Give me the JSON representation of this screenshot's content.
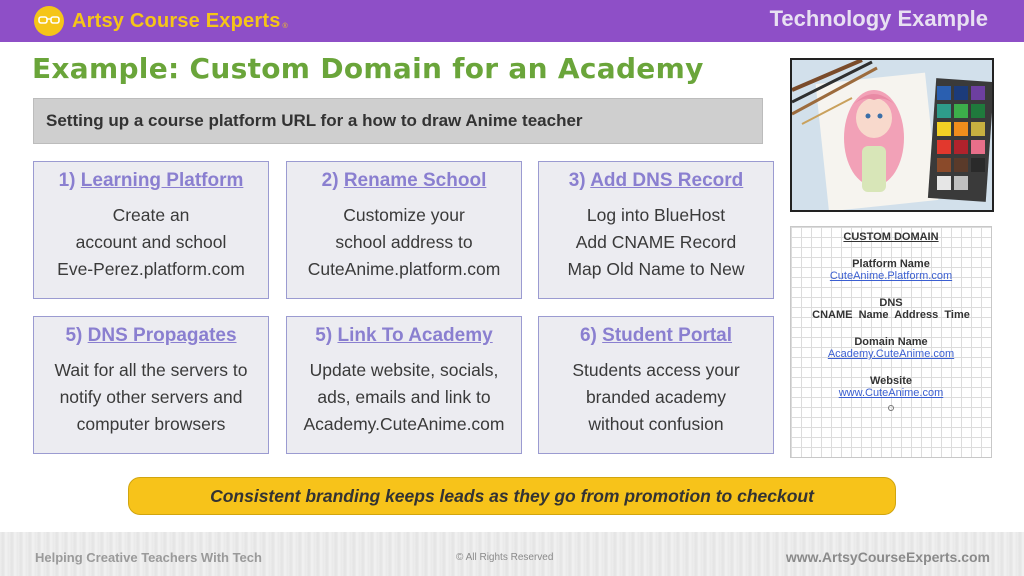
{
  "header": {
    "brand_name": "Artsy Course Experts",
    "brand_tm": "®",
    "section_label": "Technology Example"
  },
  "title": "Example: Custom Domain for an Academy",
  "subtitle": "Setting up a course platform URL for a how to draw Anime teacher",
  "steps": [
    {
      "num": "1)",
      "title": "Learning Platform",
      "lines": [
        "Create an",
        "account and school",
        "Eve-Perez.platform.com"
      ]
    },
    {
      "num": "2)",
      "title": "Rename School",
      "lines": [
        "Customize your",
        "school address to",
        "CuteAnime.platform.com"
      ]
    },
    {
      "num": "3)",
      "title": "Add DNS Record",
      "lines": [
        "Log into BlueHost",
        "Add CNAME Record",
        "Map Old Name to New"
      ]
    },
    {
      "num": "5)",
      "title": "DNS Propagates",
      "lines": [
        "Wait for all the servers to",
        "notify other servers and",
        "computer browsers"
      ]
    },
    {
      "num": "5)",
      "title": "Link To Academy",
      "lines": [
        "Update website, socials,",
        "ads, emails and link to",
        "Academy.CuteAnime.com"
      ]
    },
    {
      "num": "6)",
      "title": "Student Portal",
      "lines": [
        "Students access your",
        "branded academy",
        "without confusion"
      ]
    }
  ],
  "domain_panel": {
    "title": "CUSTOM DOMAIN",
    "platform_label": "Platform Name",
    "platform_link": "CuteAnime.Platform.com",
    "dns_label": "DNS",
    "dns_fields": "CNAME  Name  Address  Time",
    "domain_label": "Domain Name",
    "domain_link": "Academy.CuteAnime.com",
    "website_label": "Website",
    "website_link": "www.CuteAnime.com"
  },
  "banner": "Consistent branding keeps leads as they go from promotion to checkout",
  "footer": {
    "left": "Helping Creative Teachers With Tech",
    "middle": "© All Rights Reserved",
    "right": "www.ArtsyCourseExperts.com"
  },
  "colors": {
    "header_purple": "#8e4fc7",
    "brand_yellow": "#f5c518",
    "title_green": "#6aa53a",
    "step_heading": "#8a7fd0",
    "banner_yellow": "#f7c31a",
    "link_blue": "#3b5fd1"
  }
}
